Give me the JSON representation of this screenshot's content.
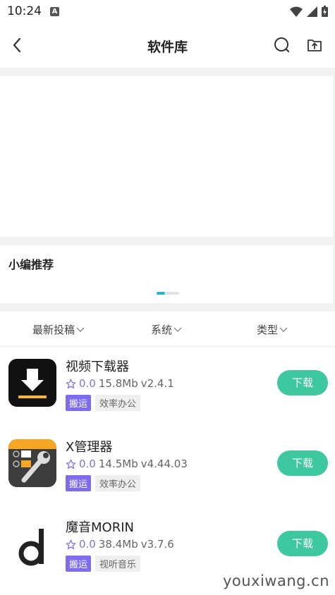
{
  "status": {
    "time": "10:24",
    "notif_glyph": "A"
  },
  "header": {
    "title": "软件库",
    "icons": [
      "back-icon",
      "search-icon",
      "upload-folder-icon"
    ]
  },
  "recommend": {
    "title": "小编推荐",
    "carousel_index": 1,
    "carousel_count": 2
  },
  "filters": [
    "最新投稿",
    "系统",
    "类型"
  ],
  "apps": [
    {
      "name": "视频下载器",
      "rating": "0.0",
      "size": "15.8Mb",
      "version": "v2.4.1",
      "tag1": "搬运",
      "tag2": "效率办公",
      "button": "下载"
    },
    {
      "name": "X管理器",
      "rating": "0.0",
      "size": "14.5Mb",
      "version": "v4.44.03",
      "tag1": "搬运",
      "tag2": "效率办公",
      "button": "下载"
    },
    {
      "name": "魔音MORIN",
      "rating": "0.0",
      "size": "38.4Mb",
      "version": "v3.7.6",
      "tag1": "搬运",
      "tag2": "视听音乐",
      "button": "下载"
    }
  ],
  "watermark": "youxiwang.cn",
  "colors": {
    "accent": "#3ec8a0",
    "tag": "#7d6bf0",
    "carousel": "#25b6d8",
    "rating": "#7d74e8"
  }
}
